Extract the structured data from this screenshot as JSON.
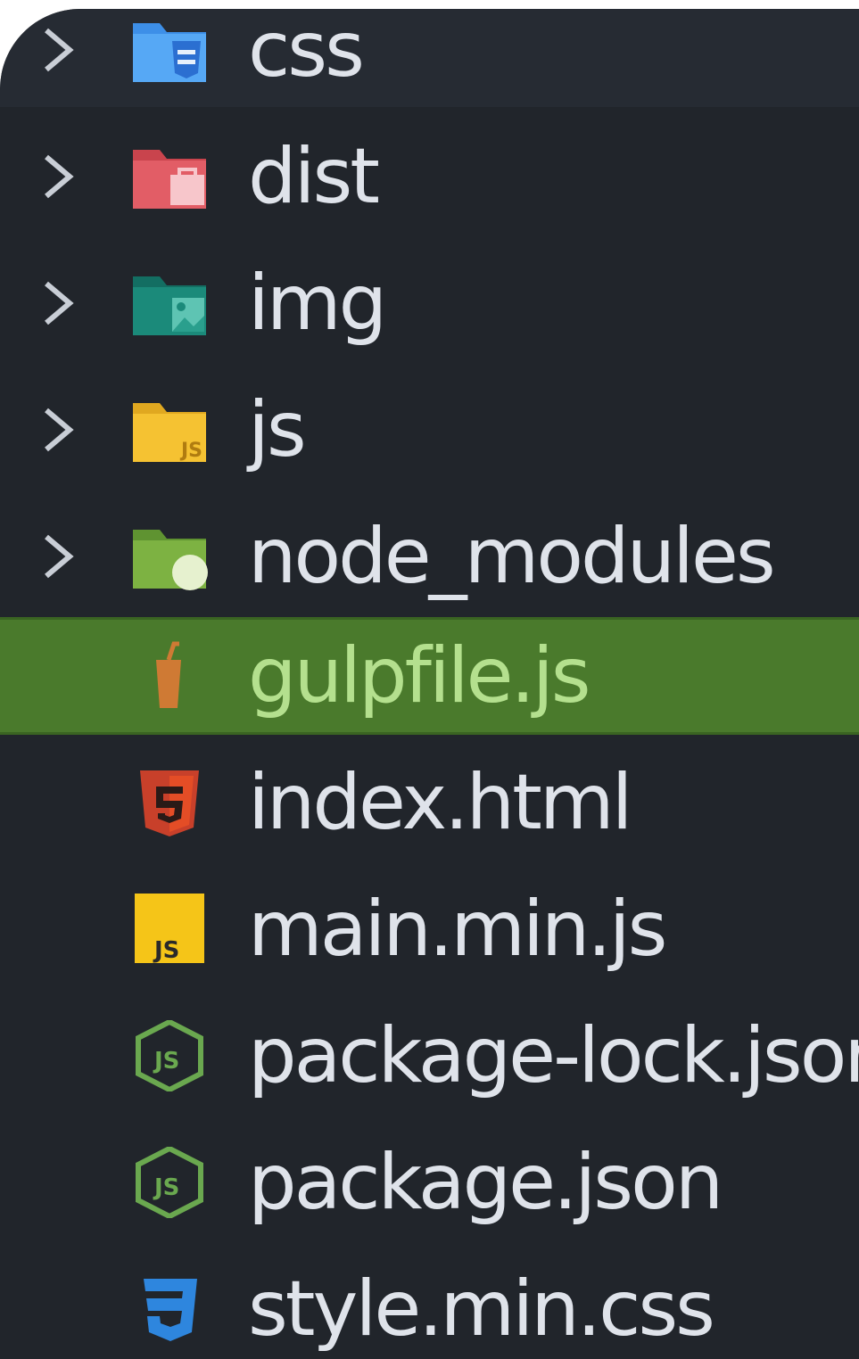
{
  "explorer": {
    "items": [
      {
        "label": "css",
        "kind": "folder",
        "icon": "css-folder-icon",
        "color": "#4a9ff0"
      },
      {
        "label": "dist",
        "kind": "folder",
        "icon": "dist-folder-icon",
        "color": "#e05a62"
      },
      {
        "label": "img",
        "kind": "folder",
        "icon": "image-folder-icon",
        "color": "#1b8a7a"
      },
      {
        "label": "js",
        "kind": "folder",
        "icon": "js-folder-icon",
        "color": "#f2c12e"
      },
      {
        "label": "node_modules",
        "kind": "folder",
        "icon": "node-folder-icon",
        "color": "#7db242"
      },
      {
        "label": "gulpfile.js",
        "kind": "file",
        "icon": "gulp-icon",
        "color": "#cf7a34",
        "selected": true
      },
      {
        "label": "index.html",
        "kind": "file",
        "icon": "html5-icon",
        "color": "#e44d26"
      },
      {
        "label": "main.min.js",
        "kind": "file",
        "icon": "javascript-icon",
        "color": "#f5c518"
      },
      {
        "label": "package-lock.json",
        "kind": "file",
        "icon": "nodejs-icon",
        "color": "#6aa84f"
      },
      {
        "label": "package.json",
        "kind": "file",
        "icon": "nodejs-icon",
        "color": "#6aa84f"
      },
      {
        "label": "style.min.css",
        "kind": "file",
        "icon": "css3-icon",
        "color": "#2e86de"
      }
    ]
  },
  "theme": {
    "background": "#21252b",
    "selection": "#4a7a2c",
    "text": "#dfe3ea",
    "selected_text": "#b4e08e"
  }
}
